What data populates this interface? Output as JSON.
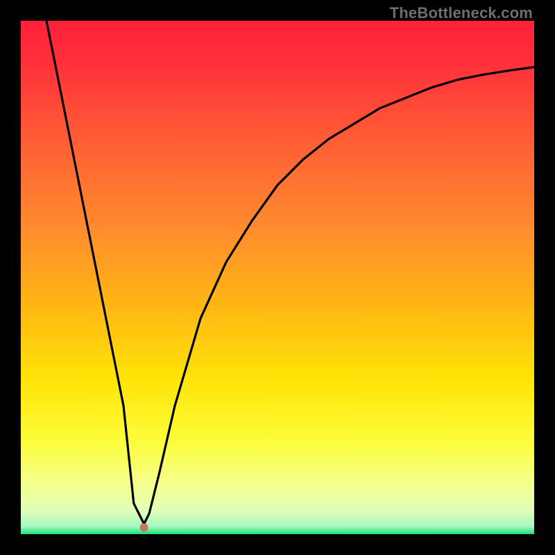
{
  "watermark": "TheBottleneck.com",
  "chart_data": {
    "type": "line",
    "title": "",
    "xlabel": "",
    "ylabel": "",
    "xlim": [
      0,
      100
    ],
    "ylim": [
      0,
      100
    ],
    "gradient_stops": [
      {
        "offset": 0,
        "color": "#ff1f3a"
      },
      {
        "offset": 0.08,
        "color": "#ff2f3b"
      },
      {
        "offset": 0.22,
        "color": "#ff5a36"
      },
      {
        "offset": 0.4,
        "color": "#ff8a2e"
      },
      {
        "offset": 0.55,
        "color": "#ffb514"
      },
      {
        "offset": 0.7,
        "color": "#ffe408"
      },
      {
        "offset": 0.82,
        "color": "#fdfd3a"
      },
      {
        "offset": 0.9,
        "color": "#f5ff8c"
      },
      {
        "offset": 0.955,
        "color": "#dfffb8"
      },
      {
        "offset": 0.985,
        "color": "#a6f7c2"
      },
      {
        "offset": 1.0,
        "color": "#18e06e"
      }
    ],
    "series": [
      {
        "name": "bottleneck-curve",
        "x": [
          5,
          10,
          15,
          20,
          22,
          24,
          25,
          27,
          30,
          35,
          40,
          45,
          50,
          55,
          60,
          65,
          70,
          75,
          80,
          85,
          90,
          95,
          100
        ],
        "y": [
          100,
          75,
          50,
          25,
          6,
          2,
          4,
          12,
          25,
          42,
          53,
          61,
          68,
          73,
          77,
          80,
          83,
          85,
          87,
          88.5,
          89.5,
          90.3,
          91
        ]
      }
    ],
    "marker": {
      "x": 24,
      "y": 1.3,
      "color": "#c77760",
      "radius": 6
    }
  }
}
